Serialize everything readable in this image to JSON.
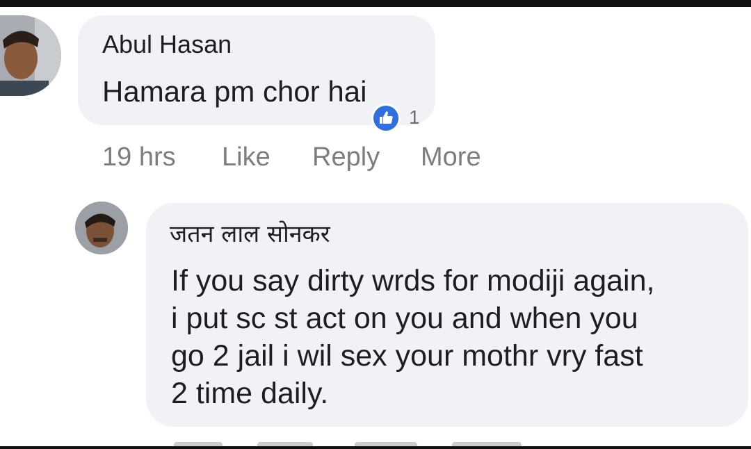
{
  "comment": {
    "author": "Abul Hasan",
    "text": "Hamara pm chor hai",
    "reaction_count": "1",
    "actions": {
      "time": "19 hrs",
      "like": "Like",
      "reply": "Reply",
      "more": "More"
    }
  },
  "reply": {
    "author": "जतन लाल सोनकर",
    "lines": [
      "If you say dirty wrds for modiji again,",
      "i put sc st act on you and when you",
      "go 2 jail i wil sex your mothr vry fast",
      "2 time daily."
    ]
  },
  "colors": {
    "bubble": "#f0f2f5",
    "action_text": "#7a7d82",
    "like_badge": "#2f6fe0"
  },
  "icons": [
    "like-thumb-icon"
  ]
}
